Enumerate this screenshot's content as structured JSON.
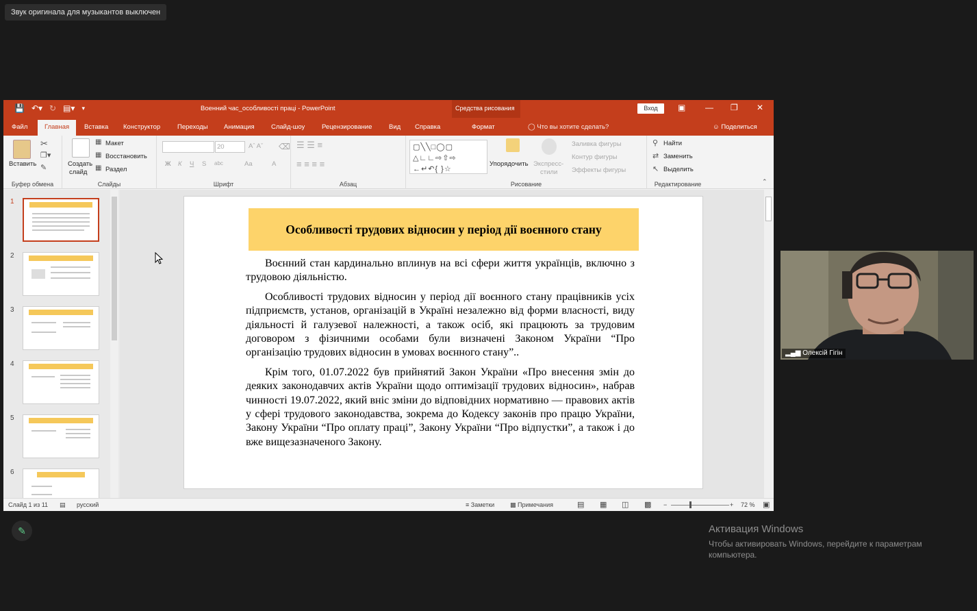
{
  "zoom_toast": "Звук оригинала для музыкантов выключен",
  "window": {
    "title": "Военний час_особливості праці  -  PowerPoint",
    "context_group": "Средства рисования",
    "signin": "Вход"
  },
  "tabs": [
    "Файл",
    "Главная",
    "Вставка",
    "Конструктор",
    "Переходы",
    "Анимация",
    "Слайд-шоу",
    "Рецензирование",
    "Вид",
    "Справка",
    "Формат"
  ],
  "active_tab": "Главная",
  "search_placeholder": "Что вы хотите сделать?",
  "share_label": "Поделиться",
  "ribbon": {
    "clipboard": {
      "paste": "Вставить",
      "label": "Буфер обмена"
    },
    "slides": {
      "new_slide_1": "Создать",
      "new_slide_2": "слайд",
      "layout": "Макет",
      "reset": "Восстановить",
      "section": "Раздел",
      "label": "Слайды"
    },
    "font": {
      "size": "20",
      "label": "Шрифт",
      "bold": "Ж",
      "italic": "К",
      "underline": "Ч",
      "strike": "S",
      "spacing": "abc",
      "case": "Aa",
      "color": "A"
    },
    "paragraph": {
      "label": "Абзац"
    },
    "drawing": {
      "arrange": "Упорядочить",
      "styles_1": "Экспресс-",
      "styles_2": "стили",
      "fill": "Заливка фигуры",
      "outline": "Контур фигуры",
      "effects": "Эффекты фигуры",
      "label": "Рисование"
    },
    "editing": {
      "find": "Найти",
      "replace": "Заменить",
      "select": "Выделить",
      "label": "Редактирование"
    }
  },
  "thumbnails": [
    "1",
    "2",
    "3",
    "4",
    "5",
    "6"
  ],
  "slide": {
    "title": "Особливості трудових відносин у період дії воєнного стану",
    "p1": "Воєнний стан кардинально вплинув на всі сфери життя українців, включно з трудовою діяльністю.",
    "p2": "Особливості трудових відносин у період дії воєнного стану працівників усіх підприємств, установ, організацій в Україні незалежно від форми власності, виду діяльності й галузевої належності, а також осіб, які працюють за трудовим договором з фізичними особами були визначені Законом України “Про організацію трудових відносин в умовах воєнного стану”..",
    "p3": "Крім того, 01.07.2022 був прийнятий Закон України «Про внесення змін до деяких законодавчих актів України щодо оптимізації трудових відносин», набрав чинності 19.07.2022, який вніс зміни до відповідних нормативно — правових актів у сфері трудового законодавства, зокрема до Кодексу законів про працю України, Закону України “Про оплату праці”, Закону України “Про відпустки”, а також і до вже вищезазначеного Закону."
  },
  "status": {
    "slide_count": "Слайд 1 из 11",
    "language": "русский",
    "notes": "Заметки",
    "comments": "Примечания",
    "zoom": "72 %"
  },
  "participant_name": "Олексій Гігін",
  "activation": {
    "title": "Активация Windows",
    "text": "Чтобы активировать Windows, перейдите к параметрам компьютера."
  }
}
